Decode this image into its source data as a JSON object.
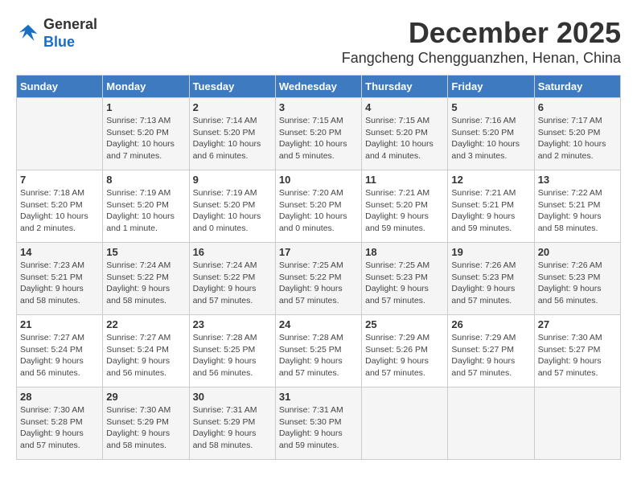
{
  "header": {
    "logo_line1": "General",
    "logo_line2": "Blue",
    "month_title": "December 2025",
    "location": "Fangcheng Chengguanzhen, Henan, China"
  },
  "weekdays": [
    "Sunday",
    "Monday",
    "Tuesday",
    "Wednesday",
    "Thursday",
    "Friday",
    "Saturday"
  ],
  "weeks": [
    [
      {
        "day": "",
        "info": ""
      },
      {
        "day": "1",
        "info": "Sunrise: 7:13 AM\nSunset: 5:20 PM\nDaylight: 10 hours\nand 7 minutes."
      },
      {
        "day": "2",
        "info": "Sunrise: 7:14 AM\nSunset: 5:20 PM\nDaylight: 10 hours\nand 6 minutes."
      },
      {
        "day": "3",
        "info": "Sunrise: 7:15 AM\nSunset: 5:20 PM\nDaylight: 10 hours\nand 5 minutes."
      },
      {
        "day": "4",
        "info": "Sunrise: 7:15 AM\nSunset: 5:20 PM\nDaylight: 10 hours\nand 4 minutes."
      },
      {
        "day": "5",
        "info": "Sunrise: 7:16 AM\nSunset: 5:20 PM\nDaylight: 10 hours\nand 3 minutes."
      },
      {
        "day": "6",
        "info": "Sunrise: 7:17 AM\nSunset: 5:20 PM\nDaylight: 10 hours\nand 2 minutes."
      }
    ],
    [
      {
        "day": "7",
        "info": "Sunrise: 7:18 AM\nSunset: 5:20 PM\nDaylight: 10 hours\nand 2 minutes."
      },
      {
        "day": "8",
        "info": "Sunrise: 7:19 AM\nSunset: 5:20 PM\nDaylight: 10 hours\nand 1 minute."
      },
      {
        "day": "9",
        "info": "Sunrise: 7:19 AM\nSunset: 5:20 PM\nDaylight: 10 hours\nand 0 minutes."
      },
      {
        "day": "10",
        "info": "Sunrise: 7:20 AM\nSunset: 5:20 PM\nDaylight: 10 hours\nand 0 minutes."
      },
      {
        "day": "11",
        "info": "Sunrise: 7:21 AM\nSunset: 5:20 PM\nDaylight: 9 hours\nand 59 minutes."
      },
      {
        "day": "12",
        "info": "Sunrise: 7:21 AM\nSunset: 5:21 PM\nDaylight: 9 hours\nand 59 minutes."
      },
      {
        "day": "13",
        "info": "Sunrise: 7:22 AM\nSunset: 5:21 PM\nDaylight: 9 hours\nand 58 minutes."
      }
    ],
    [
      {
        "day": "14",
        "info": "Sunrise: 7:23 AM\nSunset: 5:21 PM\nDaylight: 9 hours\nand 58 minutes."
      },
      {
        "day": "15",
        "info": "Sunrise: 7:24 AM\nSunset: 5:22 PM\nDaylight: 9 hours\nand 58 minutes."
      },
      {
        "day": "16",
        "info": "Sunrise: 7:24 AM\nSunset: 5:22 PM\nDaylight: 9 hours\nand 57 minutes."
      },
      {
        "day": "17",
        "info": "Sunrise: 7:25 AM\nSunset: 5:22 PM\nDaylight: 9 hours\nand 57 minutes."
      },
      {
        "day": "18",
        "info": "Sunrise: 7:25 AM\nSunset: 5:23 PM\nDaylight: 9 hours\nand 57 minutes."
      },
      {
        "day": "19",
        "info": "Sunrise: 7:26 AM\nSunset: 5:23 PM\nDaylight: 9 hours\nand 57 minutes."
      },
      {
        "day": "20",
        "info": "Sunrise: 7:26 AM\nSunset: 5:23 PM\nDaylight: 9 hours\nand 56 minutes."
      }
    ],
    [
      {
        "day": "21",
        "info": "Sunrise: 7:27 AM\nSunset: 5:24 PM\nDaylight: 9 hours\nand 56 minutes."
      },
      {
        "day": "22",
        "info": "Sunrise: 7:27 AM\nSunset: 5:24 PM\nDaylight: 9 hours\nand 56 minutes."
      },
      {
        "day": "23",
        "info": "Sunrise: 7:28 AM\nSunset: 5:25 PM\nDaylight: 9 hours\nand 56 minutes."
      },
      {
        "day": "24",
        "info": "Sunrise: 7:28 AM\nSunset: 5:25 PM\nDaylight: 9 hours\nand 57 minutes."
      },
      {
        "day": "25",
        "info": "Sunrise: 7:29 AM\nSunset: 5:26 PM\nDaylight: 9 hours\nand 57 minutes."
      },
      {
        "day": "26",
        "info": "Sunrise: 7:29 AM\nSunset: 5:27 PM\nDaylight: 9 hours\nand 57 minutes."
      },
      {
        "day": "27",
        "info": "Sunrise: 7:30 AM\nSunset: 5:27 PM\nDaylight: 9 hours\nand 57 minutes."
      }
    ],
    [
      {
        "day": "28",
        "info": "Sunrise: 7:30 AM\nSunset: 5:28 PM\nDaylight: 9 hours\nand 57 minutes."
      },
      {
        "day": "29",
        "info": "Sunrise: 7:30 AM\nSunset: 5:29 PM\nDaylight: 9 hours\nand 58 minutes."
      },
      {
        "day": "30",
        "info": "Sunrise: 7:31 AM\nSunset: 5:29 PM\nDaylight: 9 hours\nand 58 minutes."
      },
      {
        "day": "31",
        "info": "Sunrise: 7:31 AM\nSunset: 5:30 PM\nDaylight: 9 hours\nand 59 minutes."
      },
      {
        "day": "",
        "info": ""
      },
      {
        "day": "",
        "info": ""
      },
      {
        "day": "",
        "info": ""
      }
    ]
  ]
}
